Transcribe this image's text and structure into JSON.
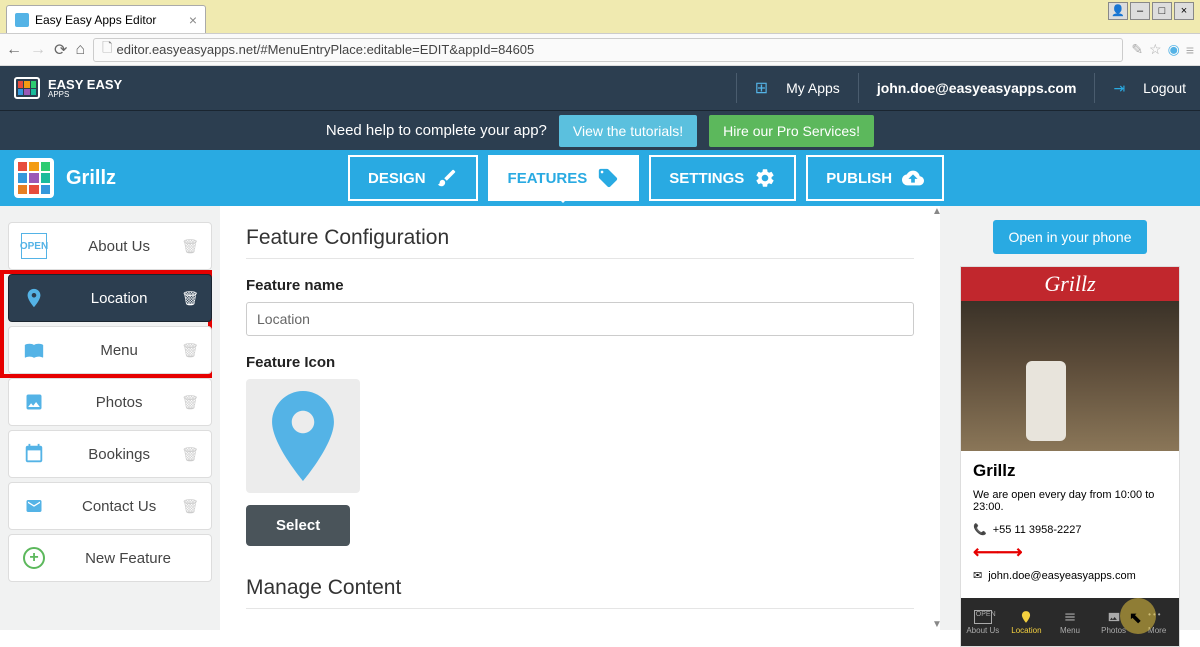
{
  "browser": {
    "tab_title": "Easy Easy Apps Editor",
    "url": "editor.easyeasyapps.net/#MenuEntryPlace:editable=EDIT&appId=84605"
  },
  "header": {
    "brand_line1": "EASY EASY",
    "brand_line2": "APPS",
    "my_apps": "My Apps",
    "user_email": "john.doe@easyeasyapps.com",
    "logout": "Logout"
  },
  "help_bar": {
    "text": "Need help to complete your app?",
    "tutorials_btn": "View the tutorials!",
    "hire_btn": "Hire our Pro Services!"
  },
  "blue_bar": {
    "app_name": "Grillz",
    "tabs": {
      "design": "DESIGN",
      "features": "FEATURES",
      "settings": "SETTINGS",
      "publish": "PUBLISH"
    }
  },
  "sidebar": {
    "items": [
      {
        "label": "About Us"
      },
      {
        "label": "Location"
      },
      {
        "label": "Menu"
      },
      {
        "label": "Photos"
      },
      {
        "label": "Bookings"
      },
      {
        "label": "Contact Us"
      },
      {
        "label": "New Feature"
      }
    ]
  },
  "content": {
    "heading1": "Feature Configuration",
    "label_name": "Feature name",
    "name_value": "Location",
    "label_icon": "Feature Icon",
    "select_btn": "Select",
    "heading2": "Manage Content"
  },
  "preview": {
    "open_btn": "Open in your phone",
    "brand": "Grillz",
    "title": "Grillz",
    "hours": "We are open every day from 10:00 to 23:00.",
    "phone": "+55 11 3958-2227",
    "email": "john.doe@easyeasyapps.com",
    "nav": {
      "about": "About Us",
      "location": "Location",
      "menu": "Menu",
      "photos": "Photos",
      "more": "More"
    }
  }
}
